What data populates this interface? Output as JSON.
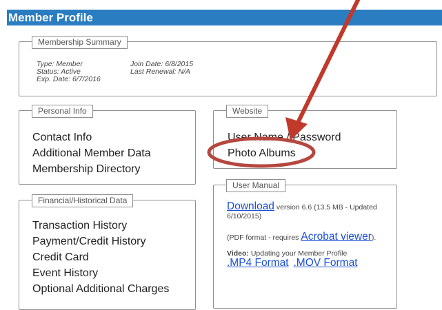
{
  "header": {
    "title": "Member Profile"
  },
  "membership_summary": {
    "legend": "Membership Summary",
    "type": "Type: Member",
    "status": "Status: Active",
    "exp_date": "Exp. Date: 6/7/2016",
    "join_date": "Join Date: 6/8/2015",
    "last_renewal": "Last Renewal: N/A"
  },
  "personal_info": {
    "legend": "Personal Info",
    "items": [
      "Contact Info",
      "Additional Member Data",
      "Membership Directory"
    ]
  },
  "website": {
    "legend": "Website",
    "items": [
      "User Name / Password",
      "Photo Albums"
    ]
  },
  "financial": {
    "legend": "Financial/Historical Data",
    "items": [
      "Transaction History",
      "Payment/Credit History",
      "Credit Card",
      "Event History",
      "Optional Additional Charges"
    ]
  },
  "user_manual": {
    "legend": "User Manual",
    "download_link": "Download",
    "download_info": "version 6.6 (13.5 MB - Updated 6/10/2015)",
    "pdf_prefix": "(PDF format - requires",
    "acrobat_link": "Acrobat viewer",
    "pdf_suffix": ").",
    "video_label": "Video:",
    "video_text": "Updating your Member Profile",
    "mp4_link": ".MP4 Format",
    "mov_link": ".MOV Format"
  },
  "annotation": {
    "arrow_color": "#c0392b",
    "circle_color": "#b5473f"
  }
}
